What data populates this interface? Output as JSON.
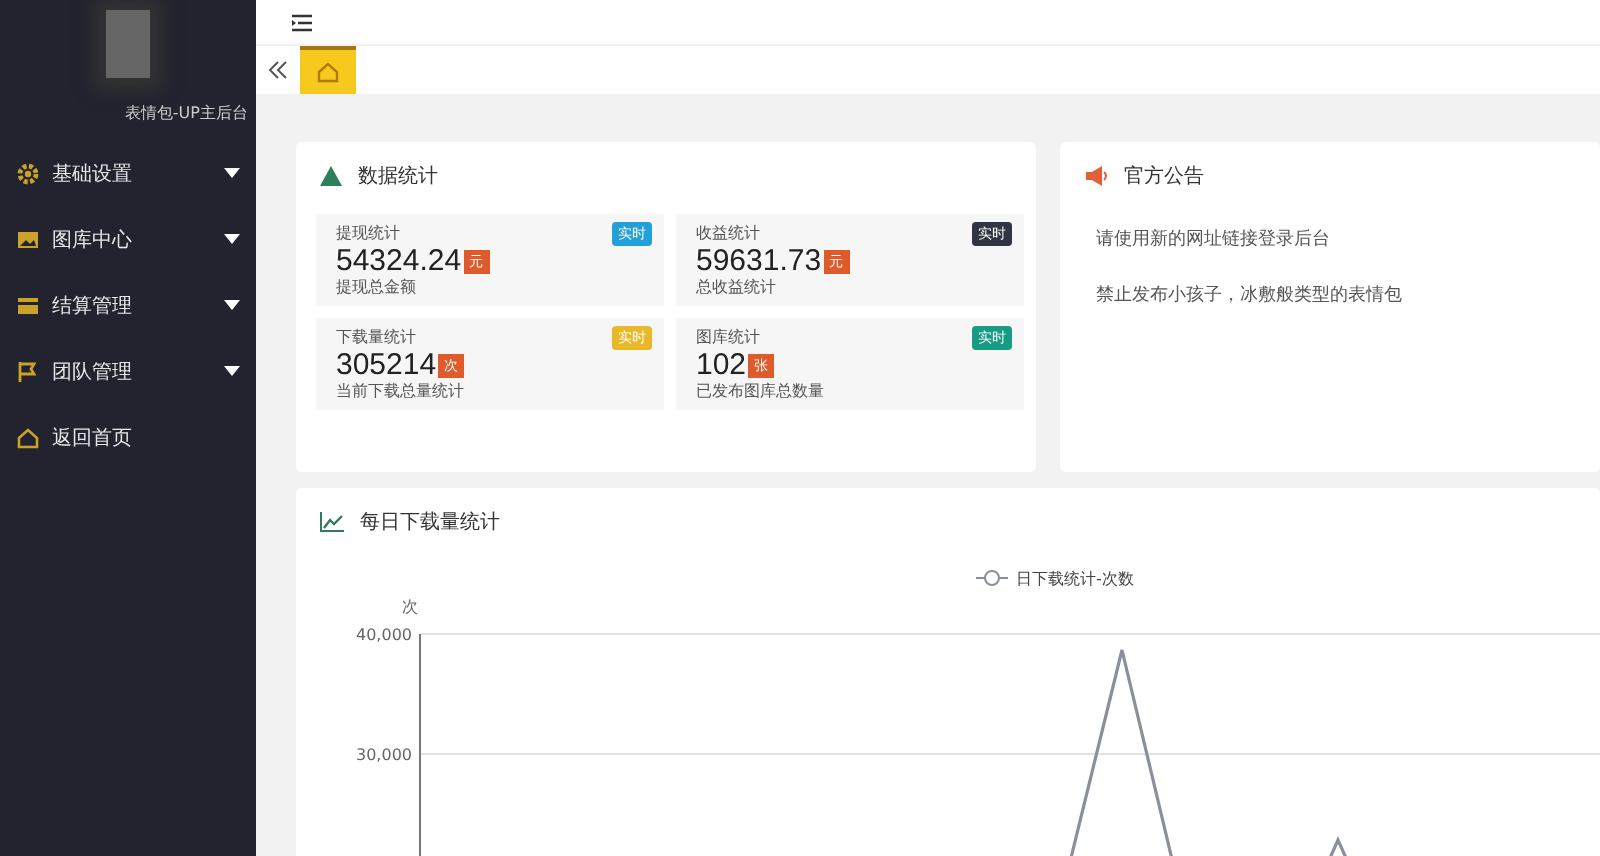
{
  "sidebar": {
    "site_name": "表情包-UP主后台",
    "items": [
      {
        "label": "基础设置",
        "expandable": true,
        "selected": false
      },
      {
        "label": "图库中心",
        "expandable": true,
        "selected": false
      },
      {
        "label": "结算管理",
        "expandable": true,
        "selected": false
      },
      {
        "label": "团队管理",
        "expandable": true,
        "selected": false
      },
      {
        "label": "返回首页",
        "expandable": false,
        "selected": false
      }
    ]
  },
  "tabs": [
    {
      "selected": true
    }
  ],
  "stats_panel": {
    "title": "数据统计",
    "tiles": [
      {
        "label": "提现统计",
        "value": "54324.24",
        "unit": "元",
        "tag": "实时",
        "color": "#23a0d8",
        "caption": "提现总金额"
      },
      {
        "label": "收益统计",
        "value": "59631.73",
        "unit": "元",
        "tag": "实时",
        "color": "#2f3542",
        "caption": "总收益统计"
      },
      {
        "label": "下载量统计",
        "value": "305214",
        "unit": "次",
        "tag": "实时",
        "color": "#e8b828",
        "caption": "当前下载总量统计"
      },
      {
        "label": "图库统计",
        "value": "102",
        "unit": "张",
        "tag": "实时",
        "color": "#169c85",
        "caption": "已发布图库总数量"
      }
    ]
  },
  "notice_panel": {
    "title": "官方公告",
    "lines": [
      "请使用新的网址链接登录后台",
      "禁止发布小孩子，冰敷般类型的表情包"
    ]
  },
  "chart_panel": {
    "title": "每日下载量统计",
    "legend": "日下载统计-次数",
    "y_unit": "次",
    "y_tick_labels": [
      "40,000",
      "30,000"
    ]
  }
}
